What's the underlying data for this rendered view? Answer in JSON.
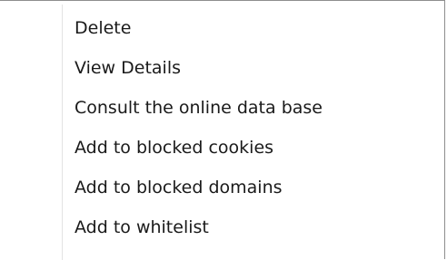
{
  "context_menu": {
    "items": [
      {
        "label": "Delete"
      },
      {
        "label": "View Details"
      },
      {
        "label": "Consult the online data base"
      },
      {
        "label": "Add to blocked cookies"
      },
      {
        "label": "Add to blocked domains"
      },
      {
        "label": "Add to whitelist"
      }
    ]
  }
}
